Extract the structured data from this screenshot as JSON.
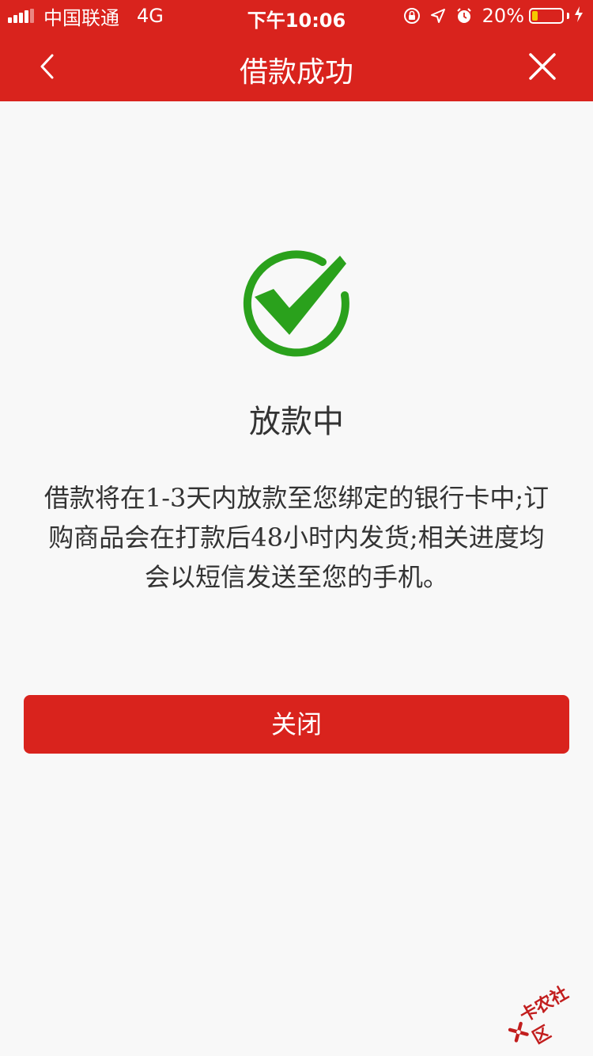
{
  "status_bar": {
    "carrier": "中国联通",
    "network": "4G",
    "time": "下午10:06",
    "battery_percent": "20%",
    "battery_level": 0.2,
    "icons": [
      "orientation-lock-icon",
      "location-arrow-icon",
      "alarm-icon",
      "battery-icon",
      "charging-bolt-icon"
    ]
  },
  "nav": {
    "title": "借款成功",
    "back_icon": "chevron-left-icon",
    "close_icon": "close-icon"
  },
  "result": {
    "icon": "success-check-icon",
    "title": "放款中",
    "description": "借款将在1-3天内放款至您绑定的银行卡中;订购商品会在打款后48小时内发货;相关进度均会以短信发送至您的手机。"
  },
  "actions": {
    "close_label": "关闭"
  },
  "watermark": {
    "text": "卡农社区"
  },
  "colors": {
    "brand_red": "#d9231d",
    "success_green": "#2aa11c",
    "background": "#f8f8f8",
    "text": "#333333"
  }
}
